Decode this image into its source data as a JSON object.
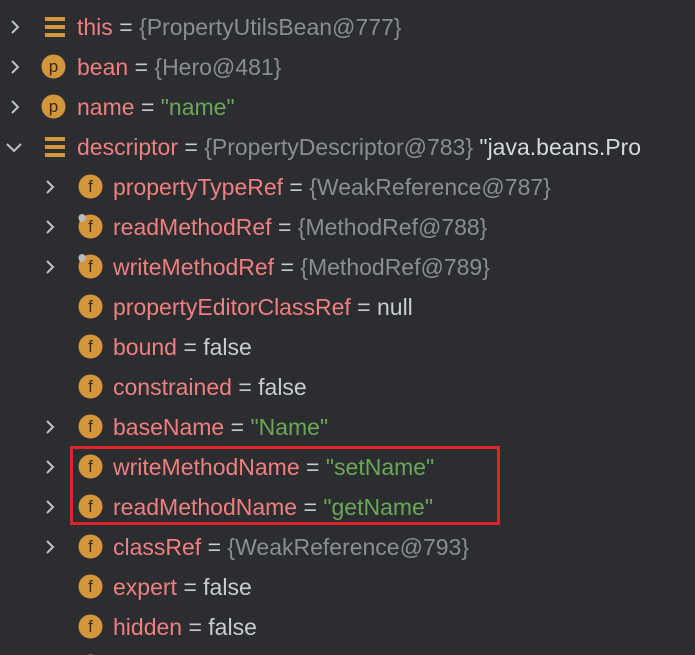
{
  "colors": {
    "background": "#2b2d30",
    "field_name": "#f07f80",
    "string_value": "#6aa757",
    "object_ref": "#8a8e94",
    "plain_value": "#c9ccd1",
    "icon_orange": "#d3963c",
    "icon_letter": "#3a2a12",
    "highlight_border": "#e0252a"
  },
  "variables": {
    "this": {
      "name": "this",
      "eq": "=",
      "value": "{PropertyUtilsBean@777}",
      "icon": "static-field-icon"
    },
    "bean": {
      "name": "bean",
      "eq": "=",
      "value": "{Hero@481}",
      "icon": "parameter-icon",
      "icon_letter": "p"
    },
    "name": {
      "name": "name",
      "eq": "=",
      "value": "\"name\"",
      "icon": "parameter-icon",
      "icon_letter": "p"
    },
    "descriptor": {
      "name": "descriptor",
      "eq": "=",
      "value": "{PropertyDescriptor@783}",
      "extra": "\"java.beans.Pro",
      "icon": "static-field-icon"
    }
  },
  "fields": [
    {
      "name": "propertyTypeRef",
      "eq": "=",
      "value": "{WeakReference@787}",
      "icon": "field-icon",
      "icon_letter": "f"
    },
    {
      "name": "readMethodRef",
      "eq": "=",
      "value": "{MethodRef@788}",
      "icon": "field-icon",
      "icon_letter": "f"
    },
    {
      "name": "writeMethodRef",
      "eq": "=",
      "value": "{MethodRef@789}",
      "icon": "field-icon",
      "icon_letter": "f"
    },
    {
      "name": "propertyEditorClassRef",
      "eq": "=",
      "value": "null",
      "icon": "field-icon",
      "icon_letter": "f"
    },
    {
      "name": "bound",
      "eq": "=",
      "value": "false",
      "icon": "field-icon",
      "icon_letter": "f"
    },
    {
      "name": "constrained",
      "eq": "=",
      "value": "false",
      "icon": "field-icon",
      "icon_letter": "f"
    },
    {
      "name": "baseName",
      "eq": "=",
      "value": "\"Name\"",
      "icon": "field-icon",
      "icon_letter": "f"
    },
    {
      "name": "writeMethodName",
      "eq": "=",
      "value": "\"setName\"",
      "icon": "field-icon",
      "icon_letter": "f"
    },
    {
      "name": "readMethodName",
      "eq": "=",
      "value": "\"getName\"",
      "icon": "field-icon",
      "icon_letter": "f"
    },
    {
      "name": "classRef",
      "eq": "=",
      "value": "{WeakReference@793}",
      "icon": "field-icon",
      "icon_letter": "f"
    },
    {
      "name": "expert",
      "eq": "=",
      "value": "false",
      "icon": "field-icon",
      "icon_letter": "f"
    },
    {
      "name": "hidden",
      "eq": "=",
      "value": "false",
      "icon": "field-icon",
      "icon_letter": "f"
    }
  ]
}
